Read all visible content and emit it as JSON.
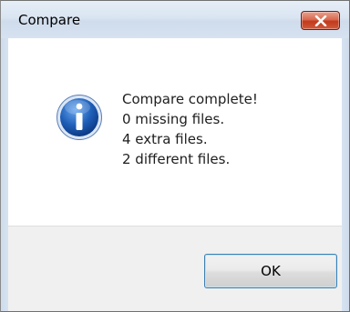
{
  "window": {
    "title": "Compare"
  },
  "dialog": {
    "icon": "info-icon",
    "messages": [
      "Compare complete!",
      "0 missing files.",
      "4 extra files.",
      "2 different files."
    ],
    "ok_label": "OK"
  },
  "colors": {
    "close_button": "#c2391b",
    "info_icon": "#1f5fb8",
    "button_border": "#3c7fb1"
  }
}
